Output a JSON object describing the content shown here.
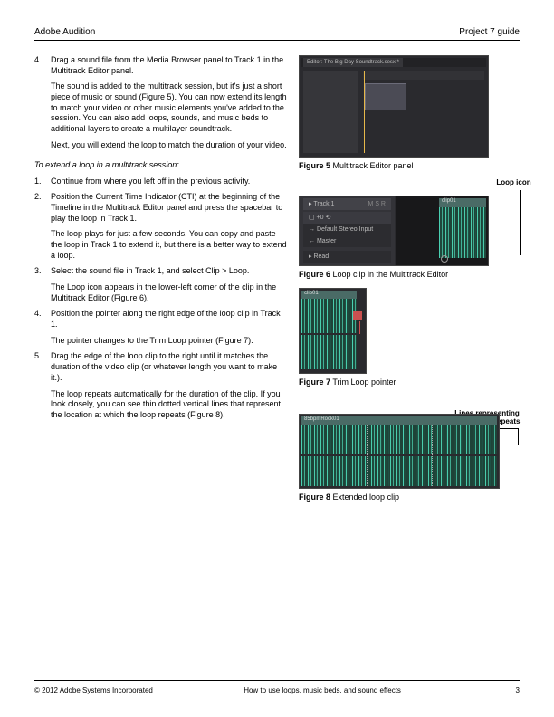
{
  "header": {
    "left": "Adobe Audition",
    "right": "Project 7 guide"
  },
  "step4": {
    "num": "4.",
    "text": "Drag a sound file from the Media Browser panel to Track 1 in the Multitrack Editor panel.",
    "para1": "The sound is added to the multitrack session, but it's just a short piece of music or sound (Figure 5). You can now extend its length to match your video or other music elements you've added to the session. You can also add loops, sounds, and music beds to additional layers to create a multilayer soundtrack.",
    "para2": "Next, you will extend the loop to match the duration of your video."
  },
  "sectionLead": "To extend a loop in a multitrack session:",
  "steps": [
    {
      "num": "1.",
      "text": "Continue from where you left off in the previous activity."
    },
    {
      "num": "2.",
      "text": "Position the Current Time Indicator (CTI) at the beginning of the Timeline in the Multitrack Editor panel and press the spacebar to play the loop in Track 1.",
      "para": "The loop plays for just a few seconds. You can copy and paste the loop in Track 1 to extend it, but there is a better way to extend a loop."
    },
    {
      "num": "3.",
      "text": "Select the sound file in Track 1, and select Clip > Loop.",
      "para": "The Loop icon appears in the lower-left corner of the clip in the Multitrack Editor (Figure 6)."
    },
    {
      "num": "4.",
      "text": "Position the pointer along the right edge of the loop clip in Track 1.",
      "para": "The pointer changes to the Trim Loop pointer (Figure 7)."
    },
    {
      "num": "5.",
      "text": "Drag the edge of the loop clip to the right until it matches the duration of the video clip (or whatever length you want to make it.).",
      "para": "The loop repeats automatically for the duration of the clip. If you look closely, you can see thin dotted vertical lines that represent the location at which the loop repeats (Figure 8)."
    }
  ],
  "figures": {
    "f5": {
      "bold": "Figure 5",
      "caption": " Multitrack Editor panel"
    },
    "f6": {
      "bold": "Figure 6",
      "caption": " Loop clip in the Multitrack Editor"
    },
    "f7": {
      "bold": "Figure 7",
      "caption": " Trim Loop pointer"
    },
    "f8": {
      "bold": "Figure 8",
      "caption": " Extended loop clip"
    },
    "annot_loop": "Loop icon",
    "annot_lines": "Lines representing where loop repeats"
  },
  "trackLabels": {
    "track1": "Track 1",
    "input": "Default Stereo Input",
    "master": "Master",
    "read": "Read",
    "clip": "clip01",
    "rock": "85bpmRock01"
  },
  "footer": {
    "left": "© 2012 Adobe Systems Incorporated",
    "center": "How to use loops, music beds, and sound effects",
    "page": "3"
  }
}
